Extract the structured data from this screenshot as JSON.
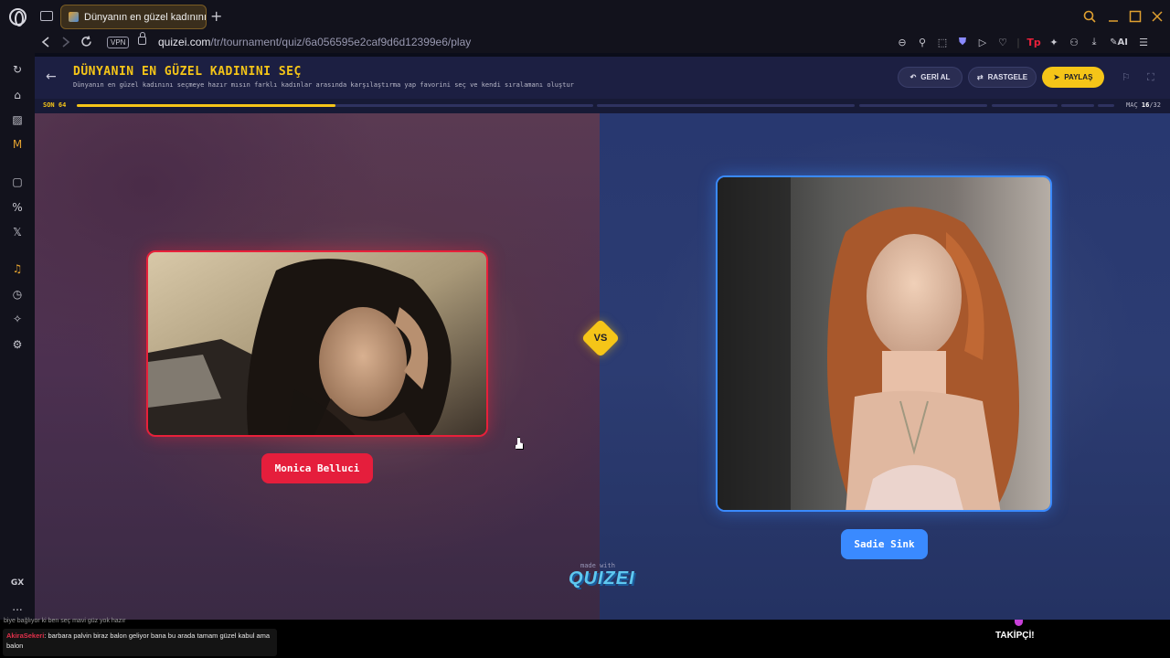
{
  "browser": {
    "tab_title": "Dünyanın en güzel kadınını",
    "new_tab": "+",
    "vpn": "VPN",
    "url_host": "quizei.com",
    "url_path": "/tr/tournament/quiz/6a056595e2caf9d6d12399e6/play",
    "ai_label": "AI"
  },
  "sidebar": {
    "gx_label": "GX",
    "more": "..."
  },
  "quiz": {
    "title": "DÜNYANIN EN GÜZEL KADININI SEÇ",
    "subtitle": "Dünyanın en güzel kadınını seçmeye hazır mısın farklı kadınlar arasında karşılaştırma yap favorini seç ve kendi sıralamanı oluştur",
    "undo_label": "GERİ AL",
    "random_label": "RASTGELE",
    "share_label": "PAYLAŞ",
    "round_label": "SON 64",
    "match_prefix": "MAÇ",
    "match_current": "16",
    "match_total": "/32",
    "progress_fraction": 0.5,
    "vs": "VS",
    "left_name": "Monica Belluci",
    "right_name": "Sadie Sink",
    "made_with": "made with",
    "brand": "QUIZEI"
  },
  "overlay": {
    "chat_top": "biye bağlıyor ki ben seç mavi güz yok hazır",
    "chat_user": "AkiraSekeri",
    "chat_sep": ": ",
    "chat_message": "barbara palvin biraz balon geliyor bana bu arada tamam güzel kabul ama balon",
    "follower_label": "TAKİPÇİ!"
  },
  "colors": {
    "accent": "#f5c518",
    "left": "#e51e3c",
    "right": "#3a8aff"
  }
}
